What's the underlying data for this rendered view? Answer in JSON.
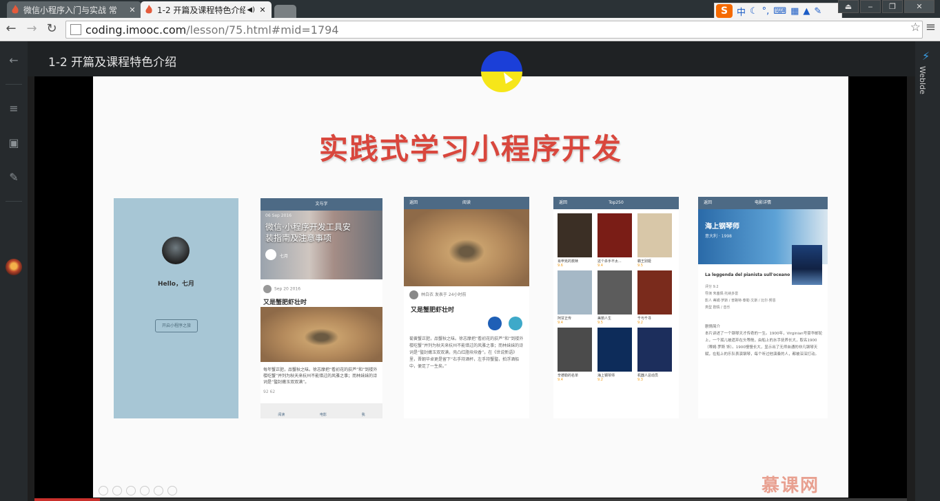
{
  "browser": {
    "tabs": [
      {
        "title": "微信小程序入门与实战 常",
        "active": false
      },
      {
        "title": "1-2 开篇及课程特色介绍",
        "active": true
      }
    ],
    "url_host": "coding.imooc.com",
    "url_path": "/lesson/75.html#mid=1794",
    "ime": {
      "brand": "S",
      "mode": "中"
    },
    "close_glyph": "✕"
  },
  "page": {
    "lesson_title": "1-2 开篇及课程特色介绍",
    "right_sidebar_label": "WebIde",
    "progress_fraction": 0.075,
    "accent": "#c9302c"
  },
  "slide": {
    "title": "实践式学习小程序开发",
    "logo": "慕课网",
    "screen1": {
      "greeting": "Hello，七月",
      "button": "开启小程序之旅"
    },
    "screen2": {
      "bar": "文与字",
      "date": "06 Sep 2016",
      "headline": "微信·小程序开发工具安装指南及注意事项",
      "author": "七月",
      "meta_date": "Sep 20 2016",
      "title": "又是蟹肥虾壮时",
      "text": "每年蟹正肥，品蟹秋之味。徐志摩把“看初花的荻芦”和“到楼外楼吃蟹”并列为秋天来杭州不能错过的风雅之事；而林妹妹的诗词是“螯封嫩玉双双满”。",
      "counts": "92    62",
      "tabs": [
        "阅读",
        "电影",
        "我"
      ]
    },
    "screen3": {
      "bar": "阅读",
      "back": "返回",
      "author": "林白衣  发表于  24小时前",
      "title": "又是蟹肥虾壮时",
      "text": "菊黄蟹正肥，品蟹秋之味。徐志摩把“看初花的荻芦”和“到楼外楼吃蟹”并列为秋天来杭州不能错过的风雅之事；而林妹妹的诗词是“螯封嫩玉双双满，壳凸红脂块块香”。在《世说新语》里，晋朝毕卓更是留下“右手持酒杯，左手持蟹螯，拍浮酒船中，便足了一生矣。”"
    },
    "screen4": {
      "bar": "Top250",
      "back": "返回",
      "movies": [
        {
          "title": "肖申克的救赎",
          "score": "9.6"
        },
        {
          "title": "这个杀手不太...",
          "score": "9.4"
        },
        {
          "title": "霸王别姬",
          "score": "9.5"
        },
        {
          "title": "阿甘正传",
          "score": "9.4"
        },
        {
          "title": "美丽人生",
          "score": "9.5"
        },
        {
          "title": "千与千寻",
          "score": "9.2"
        },
        {
          "title": "辛德勒的名单",
          "score": "9.4"
        },
        {
          "title": "海上钢琴师",
          "score": "9.2"
        },
        {
          "title": "机器人总动员",
          "score": "9.3"
        }
      ]
    },
    "screen5": {
      "bar": "电影详情",
      "back": "返回",
      "movie": "海上钢琴师",
      "sub": "意大利 · 1998",
      "original": "La leggenda del pianista sull'oceano",
      "rows": [
        "评分    9.2",
        "导演    朱塞佩·托纳多雷",
        "影人    蒂姆·罗斯 / 普路特·泰勒·文斯 / 比尔·努恩",
        "类型    剧情 / 音乐"
      ],
      "intro_title": "剧情简介",
      "text": "本片讲述了一个钢琴天才传奇的一生。1900年，Virginian号豪华邮轮上，一个孤儿被遗弃在头等舱，由船上的水手抚养长大，取名1900（蒂姆·罗斯 饰）。1900慢慢长大，显示出了无师自通的非凡钢琴天赋，在船上的乐队表演钢琴，每个听过他演奏的人，都被深深打动。"
    }
  }
}
